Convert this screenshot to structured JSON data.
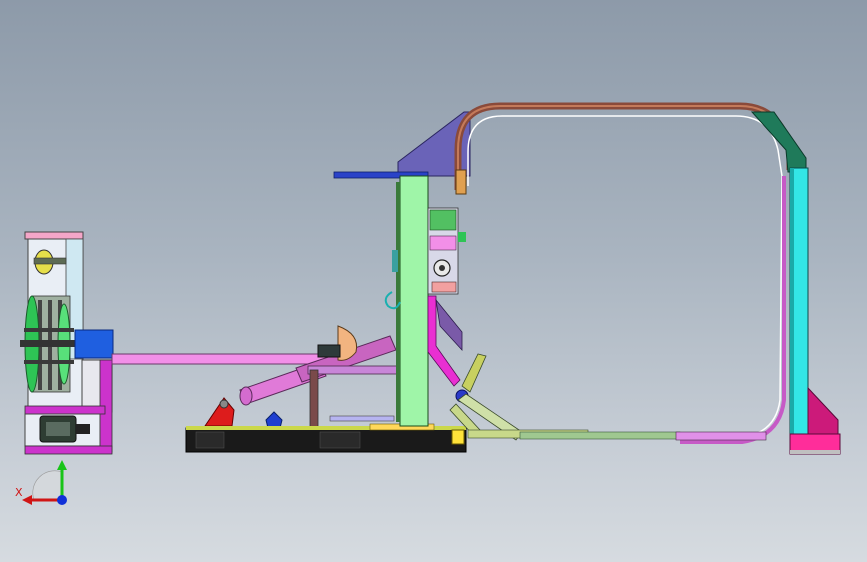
{
  "viewport": {
    "background_top": "#8d9aa9",
    "background_bottom": "#d6dbe0"
  },
  "model": {
    "parts": [
      {
        "name": "winder-frame",
        "color": "#e8e8f0"
      },
      {
        "name": "motor-base",
        "color": "#cc33cc"
      },
      {
        "name": "spindle-box",
        "color": "#1f5fe0"
      },
      {
        "name": "guide-rail",
        "color": "#f28fe8"
      },
      {
        "name": "hydraulic-cylinder",
        "color": "#e07ad8"
      },
      {
        "name": "base-skid",
        "color": "#1a1a1a"
      },
      {
        "name": "main-column",
        "color": "#9ff5a8"
      },
      {
        "name": "loop-frame",
        "color": "#8a4a3a"
      },
      {
        "name": "right-column",
        "color": "#33e6e6"
      },
      {
        "name": "right-foot",
        "color": "#ff2d9a"
      },
      {
        "name": "top-bracket",
        "color": "#6a63b8"
      }
    ]
  },
  "triad": {
    "x_label": "X",
    "x_color": "#d01515",
    "y_color": "#18c418",
    "z_color": "#1030d8"
  }
}
